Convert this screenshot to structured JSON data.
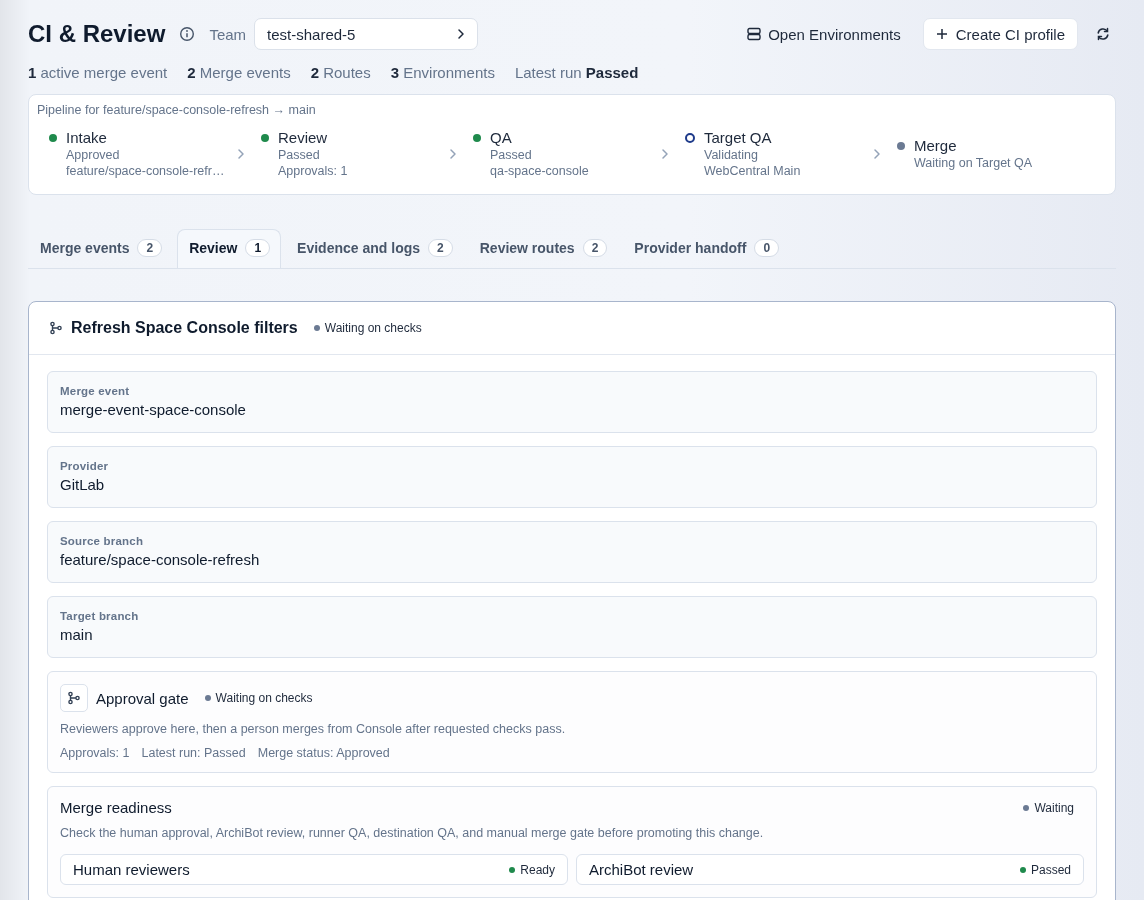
{
  "header": {
    "title": "CI & Review",
    "team_label": "Team",
    "team_value": "test-shared-5",
    "actions": [
      {
        "kind": "link",
        "label": "Open Environments"
      },
      {
        "kind": "button",
        "label": "Create CI profile"
      }
    ]
  },
  "stats": [
    "**1** active merge event",
    "**2** Merge events",
    "**2** Routes",
    "**3** Environments",
    "Latest run **Passed**"
  ],
  "pipeline": {
    "caption": "Pipeline for feature/space-console-refresh → main",
    "steps": [
      {
        "name": "Intake",
        "color": "#1f8a4c",
        "hollow": false,
        "lines": [
          "Approved",
          "feature/space-console-refr…"
        ]
      },
      {
        "name": "Review",
        "color": "#1f8a4c",
        "hollow": false,
        "lines": [
          "Passed",
          "Approvals: 1"
        ]
      },
      {
        "name": "QA",
        "color": "#1f8a4c",
        "hollow": false,
        "lines": [
          "Passed",
          "qa-space-console"
        ]
      },
      {
        "name": "Target QA",
        "color": "#1e3a8a",
        "hollow": true,
        "lines": [
          "Validating",
          "WebCentral Main"
        ]
      },
      {
        "name": "Merge",
        "color": "#6b7a93",
        "hollow": false,
        "lines": [
          "Waiting on Target QA"
        ]
      }
    ]
  },
  "tabs": [
    {
      "label": "Merge events",
      "count": "2",
      "selected": false
    },
    {
      "label": "Review",
      "count": "1",
      "selected": true
    },
    {
      "label": "Evidence and logs",
      "count": "2",
      "selected": false
    },
    {
      "label": "Review routes",
      "count": "2",
      "selected": false
    },
    {
      "label": "Provider handoff",
      "count": "0",
      "selected": false
    }
  ],
  "event": {
    "title": "Refresh Space Console filters",
    "status": "Waiting on checks",
    "color": "#6b7a93",
    "fields": [
      {
        "label": "Merge event",
        "value": "merge-event-space-console"
      },
      {
        "label": "Provider",
        "value": "GitLab"
      },
      {
        "label": "Source branch",
        "value": "feature/space-console-refresh"
      },
      {
        "label": "Target branch",
        "value": "main"
      }
    ],
    "approval_gate": {
      "title": "Approval gate",
      "status": "Waiting on checks",
      "color": "#6b7a93",
      "description": "Reviewers approve here, then a person merges from Console after requested checks pass.",
      "facts": [
        "Approvals: 1",
        "Latest run: Passed",
        "Merge status: Approved"
      ]
    },
    "readiness": {
      "title": "Merge readiness",
      "status": "Waiting",
      "color": "#6b7a93",
      "description": "Check the human approval, ArchiBot review, runner QA, destination QA, and manual merge gate before promoting this change.",
      "checks": [
        {
          "title": "Human reviewers",
          "status": "Ready",
          "color": "#1f8a4c"
        },
        {
          "title": "ArchiBot review",
          "status": "Passed",
          "color": "#1f8a4c"
        }
      ]
    }
  }
}
